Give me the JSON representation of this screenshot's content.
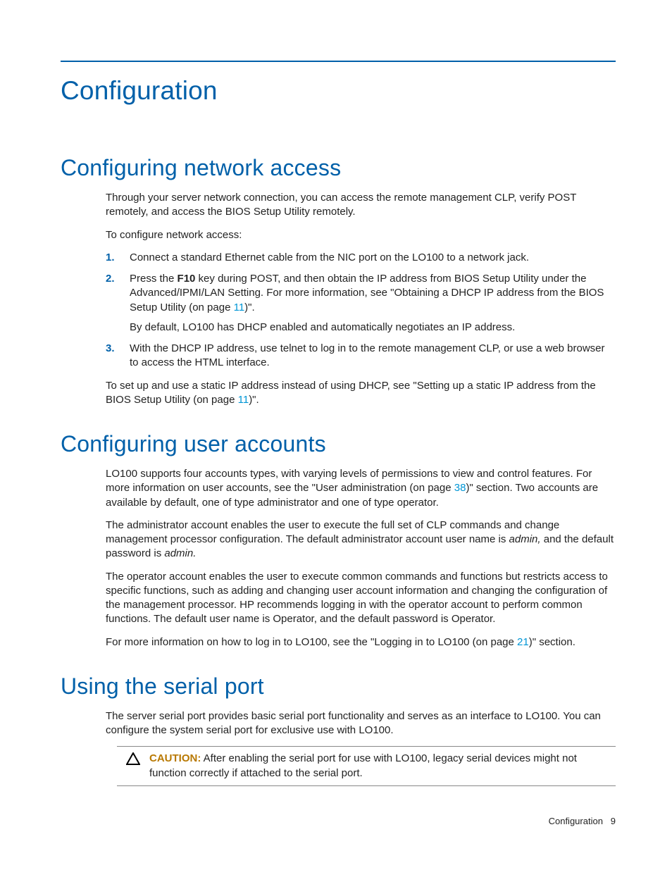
{
  "chapter_title": "Configuration",
  "sections": {
    "net": {
      "title": "Configuring network access",
      "intro": "Through your server network connection, you can access the remote management CLP, verify POST remotely, and access the BIOS Setup Utility remotely.",
      "lead": "To configure network access:",
      "steps": {
        "s1": "Connect a standard Ethernet cable from the NIC port on the LO100 to a network jack.",
        "s2_a": "Press the ",
        "s2_key": "F10",
        "s2_b": " key during POST, and then obtain the IP address from BIOS Setup Utility under the Advanced/IPMI/LAN Setting. For more information, see \"Obtaining a DHCP IP address from the BIOS Setup Utility (on page ",
        "s2_page": "11",
        "s2_c": ")\".",
        "s2_note": "By default, LO100 has DHCP enabled and automatically negotiates an IP address.",
        "s3": "With the DHCP IP address, use telnet to log in to the remote management CLP, or use a web browser to access the HTML interface."
      },
      "outro_a": "To set up and use a static IP address instead of using DHCP, see \"Setting up a static IP address from the BIOS Setup Utility (on page ",
      "outro_page": "11",
      "outro_b": ")\"."
    },
    "users": {
      "title": "Configuring user accounts",
      "p1_a": "LO100 supports four accounts types, with varying levels of permissions to view and control features. For more information on user accounts, see the \"User administration (on page ",
      "p1_page": "38",
      "p1_b": ")\" section. Two accounts are available by default, one of type administrator and one of type operator.",
      "p2_a": "The administrator account enables the user to execute the full set of CLP commands and change management processor configuration. The default administrator account user name is ",
      "p2_admin1": "admin,",
      "p2_b": " and the default password is ",
      "p2_admin2": "admin.",
      "p3": "The operator account enables the user to execute common commands and functions but restricts access to specific functions, such as adding and changing user account information and changing the configuration of the management processor. HP recommends logging in with the operator account to perform common functions. The default user name is Operator, and the default password is Operator.",
      "p4_a": "For more information on how to log in to LO100, see the \"Logging in to LO100 (on page ",
      "p4_page": "21",
      "p4_b": ")\" section."
    },
    "serial": {
      "title": "Using the serial port",
      "p1": "The server serial port provides basic serial port functionality and serves as an interface to LO100. You can configure the system serial port for exclusive use with LO100.",
      "caution_label": "CAUTION:",
      "caution_text": "  After enabling the serial port for use with LO100, legacy serial devices might not function correctly if attached to the serial port."
    }
  },
  "footer": {
    "label": "Configuration",
    "page": "9"
  }
}
